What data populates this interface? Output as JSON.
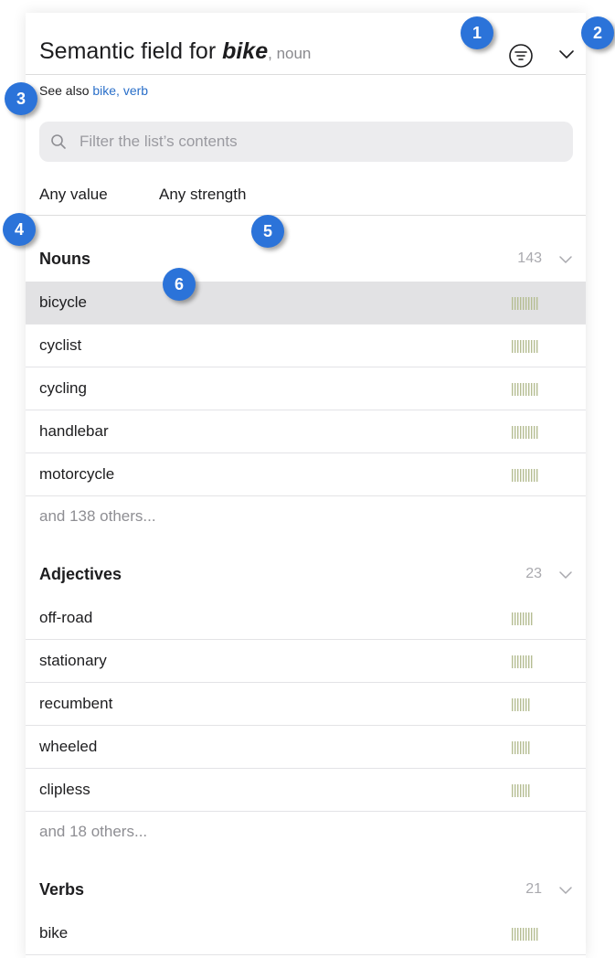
{
  "header": {
    "title": "Semantic field for ",
    "word": "bike",
    "pos": ", noun",
    "filter_icon": "filter-lines-icon",
    "collapse_icon": "chevron-down-icon"
  },
  "see_also": {
    "label": "See also ",
    "link": "bike, verb"
  },
  "search": {
    "placeholder": "Filter the list’s contents",
    "value": ""
  },
  "filters": {
    "value": "Any value",
    "strength": "Any strength"
  },
  "sections": [
    {
      "label": "Nouns",
      "count": "143",
      "items": [
        {
          "word": "bicycle",
          "strength": 10,
          "selected": true
        },
        {
          "word": "cyclist",
          "strength": 10
        },
        {
          "word": "cycling",
          "strength": 10
        },
        {
          "word": "handlebar",
          "strength": 10
        },
        {
          "word": "motorcycle",
          "strength": 10
        }
      ],
      "others": "and 138 others..."
    },
    {
      "label": "Adjectives",
      "count": "23",
      "items": [
        {
          "word": "off-road",
          "strength": 8
        },
        {
          "word": "stationary",
          "strength": 8
        },
        {
          "word": "recumbent",
          "strength": 7
        },
        {
          "word": "wheeled",
          "strength": 7
        },
        {
          "word": "clipless",
          "strength": 7
        }
      ],
      "others": "and 18 others..."
    },
    {
      "label": "Verbs",
      "count": "21",
      "items": [
        {
          "word": "bike",
          "strength": 10
        }
      ]
    }
  ],
  "badges": [
    "1",
    "2",
    "3",
    "4",
    "5",
    "6"
  ],
  "colors": {
    "accent": "#2b73d9",
    "link": "#2a6fc9",
    "strength_bar": "#b5bd92",
    "selected_row": "#e2e2e4"
  }
}
